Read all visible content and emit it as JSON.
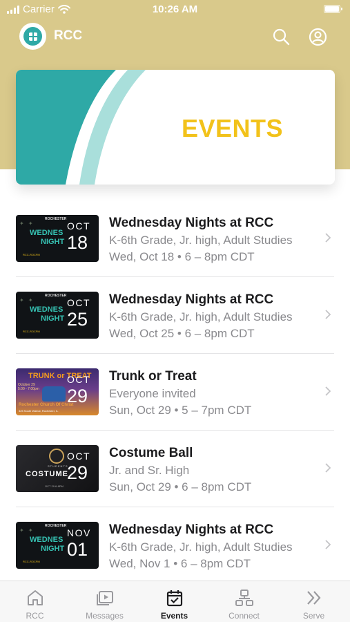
{
  "status_bar": {
    "carrier": "Carrier",
    "time": "10:26 AM"
  },
  "header": {
    "title": "RCC"
  },
  "hero": {
    "title": "EVENTS"
  },
  "events": [
    {
      "title": "Wednesday Nights at RCC",
      "subtitle": "K-6th Grade, Jr. high, Adult Studies",
      "date": "Wed, Oct 18 • 6 – 8pm CDT",
      "thumb": {
        "month": "OCT",
        "day": "18",
        "text_1": "WEDNES",
        "text_2": "NIGHT",
        "brand": "ROCHESTER",
        "footer": "RCC-ROCFM"
      }
    },
    {
      "title": "Wednesday Nights at RCC",
      "subtitle": "K-6th Grade, Jr. high, Adult Studies",
      "date": "Wed, Oct 25 • 6 – 8pm CDT",
      "thumb": {
        "month": "OCT",
        "day": "25",
        "text_1": "WEDNES",
        "text_2": "NIGHT",
        "brand": "ROCHESTER",
        "footer": "RCC-ROCFM"
      }
    },
    {
      "title": "Trunk or Treat",
      "subtitle": "Everyone invited",
      "date": "Sun, Oct 29 • 5 – 7pm CDT",
      "thumb": {
        "month": "OCT",
        "day": "29",
        "text_1": "TRUNK or TREAT",
        "text_2": "October 29 5:00 - 7:00pm",
        "brand": "Rochester Church Of Christ",
        "footer": "325 South Walnut, Rochester, IL"
      }
    },
    {
      "title": "Costume Ball",
      "subtitle": "Jr. and Sr. High",
      "date": "Sun, Oct 29 • 6 – 8pm CDT",
      "thumb": {
        "month": "OCT",
        "day": "29",
        "text_1": "COSTUME",
        "text_2": "STUDENTS",
        "brand": "",
        "footer": "OCT 29 6-8PM"
      }
    },
    {
      "title": "Wednesday Nights at RCC",
      "subtitle": "K-6th Grade, Jr. high, Adult Studies",
      "date": "Wed, Nov 1 • 6 – 8pm CDT",
      "thumb": {
        "month": "NOV",
        "day": "01",
        "text_1": "WEDNES",
        "text_2": "NIGHT",
        "brand": "ROCHESTER",
        "footer": "RCC-ROCFM"
      }
    }
  ],
  "tabs": [
    {
      "label": "RCC",
      "icon": "home-icon",
      "active": false
    },
    {
      "label": "Messages",
      "icon": "video-library-icon",
      "active": false
    },
    {
      "label": "Events",
      "icon": "calendar-icon",
      "active": true
    },
    {
      "label": "Connect",
      "icon": "people-network-icon",
      "active": false
    },
    {
      "label": "Serve",
      "icon": "double-chevron-right-icon",
      "active": false
    }
  ],
  "colors": {
    "hero_bg": "#d9c98b",
    "accent_teal": "#2ea9a6",
    "events_yellow": "#f2c21a"
  }
}
